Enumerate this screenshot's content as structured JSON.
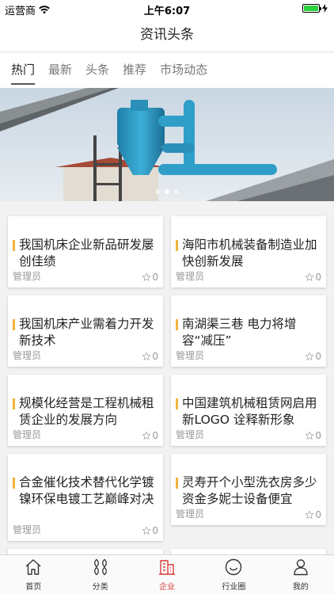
{
  "status_bar": {
    "carrier": "运营商",
    "time": "上午6:07"
  },
  "nav": {
    "title": "资讯头条"
  },
  "tabs": [
    {
      "label": "热门",
      "active": true
    },
    {
      "label": "最新",
      "active": false
    },
    {
      "label": "头条",
      "active": false
    },
    {
      "label": "推荐",
      "active": false
    },
    {
      "label": "市场动态",
      "active": false
    }
  ],
  "banner": {
    "slides": 3,
    "active_slide": 1
  },
  "articles": [
    {
      "title": "我国机床企业新品研发屡创佳绩",
      "author": "管理员",
      "likes": "0"
    },
    {
      "title": "海阳市机械装备制造业加快创新发展",
      "author": "管理员",
      "likes": "0"
    },
    {
      "title": "我国机床产业需着力开发新技术",
      "author": "管理员",
      "likes": "0"
    },
    {
      "title": "南湖渠三巷 电力将增容“减压”",
      "author": "管理员",
      "likes": "0"
    },
    {
      "title": "规模化经营是工程机械租赁企业的发展方向",
      "author": "管理员",
      "likes": "0"
    },
    {
      "title": "中国建筑机械租赁网启用新LOGO 诠释新形象",
      "author": "管理员",
      "likes": "0"
    },
    {
      "title": "合金催化技术替代化学镀镍环保电镀工艺巅峰对决",
      "author": "管理员",
      "likes": "0"
    },
    {
      "title": "灵寿开个小型洗衣房多少资金多妮士设备便宜",
      "author": "管理员",
      "likes": "0"
    }
  ],
  "tab_bar": [
    {
      "label": "首页",
      "icon": "home-icon",
      "active": false
    },
    {
      "label": "分类",
      "icon": "category-icon",
      "active": false
    },
    {
      "label": "企业",
      "icon": "company-icon",
      "active": true
    },
    {
      "label": "行业圈",
      "icon": "circle-icon",
      "active": false
    },
    {
      "label": "我的",
      "icon": "user-icon",
      "active": false
    }
  ],
  "colors": {
    "accent": "#d83b3b",
    "headline_marker": "#f2b43b",
    "battery": "#2bd13f"
  }
}
